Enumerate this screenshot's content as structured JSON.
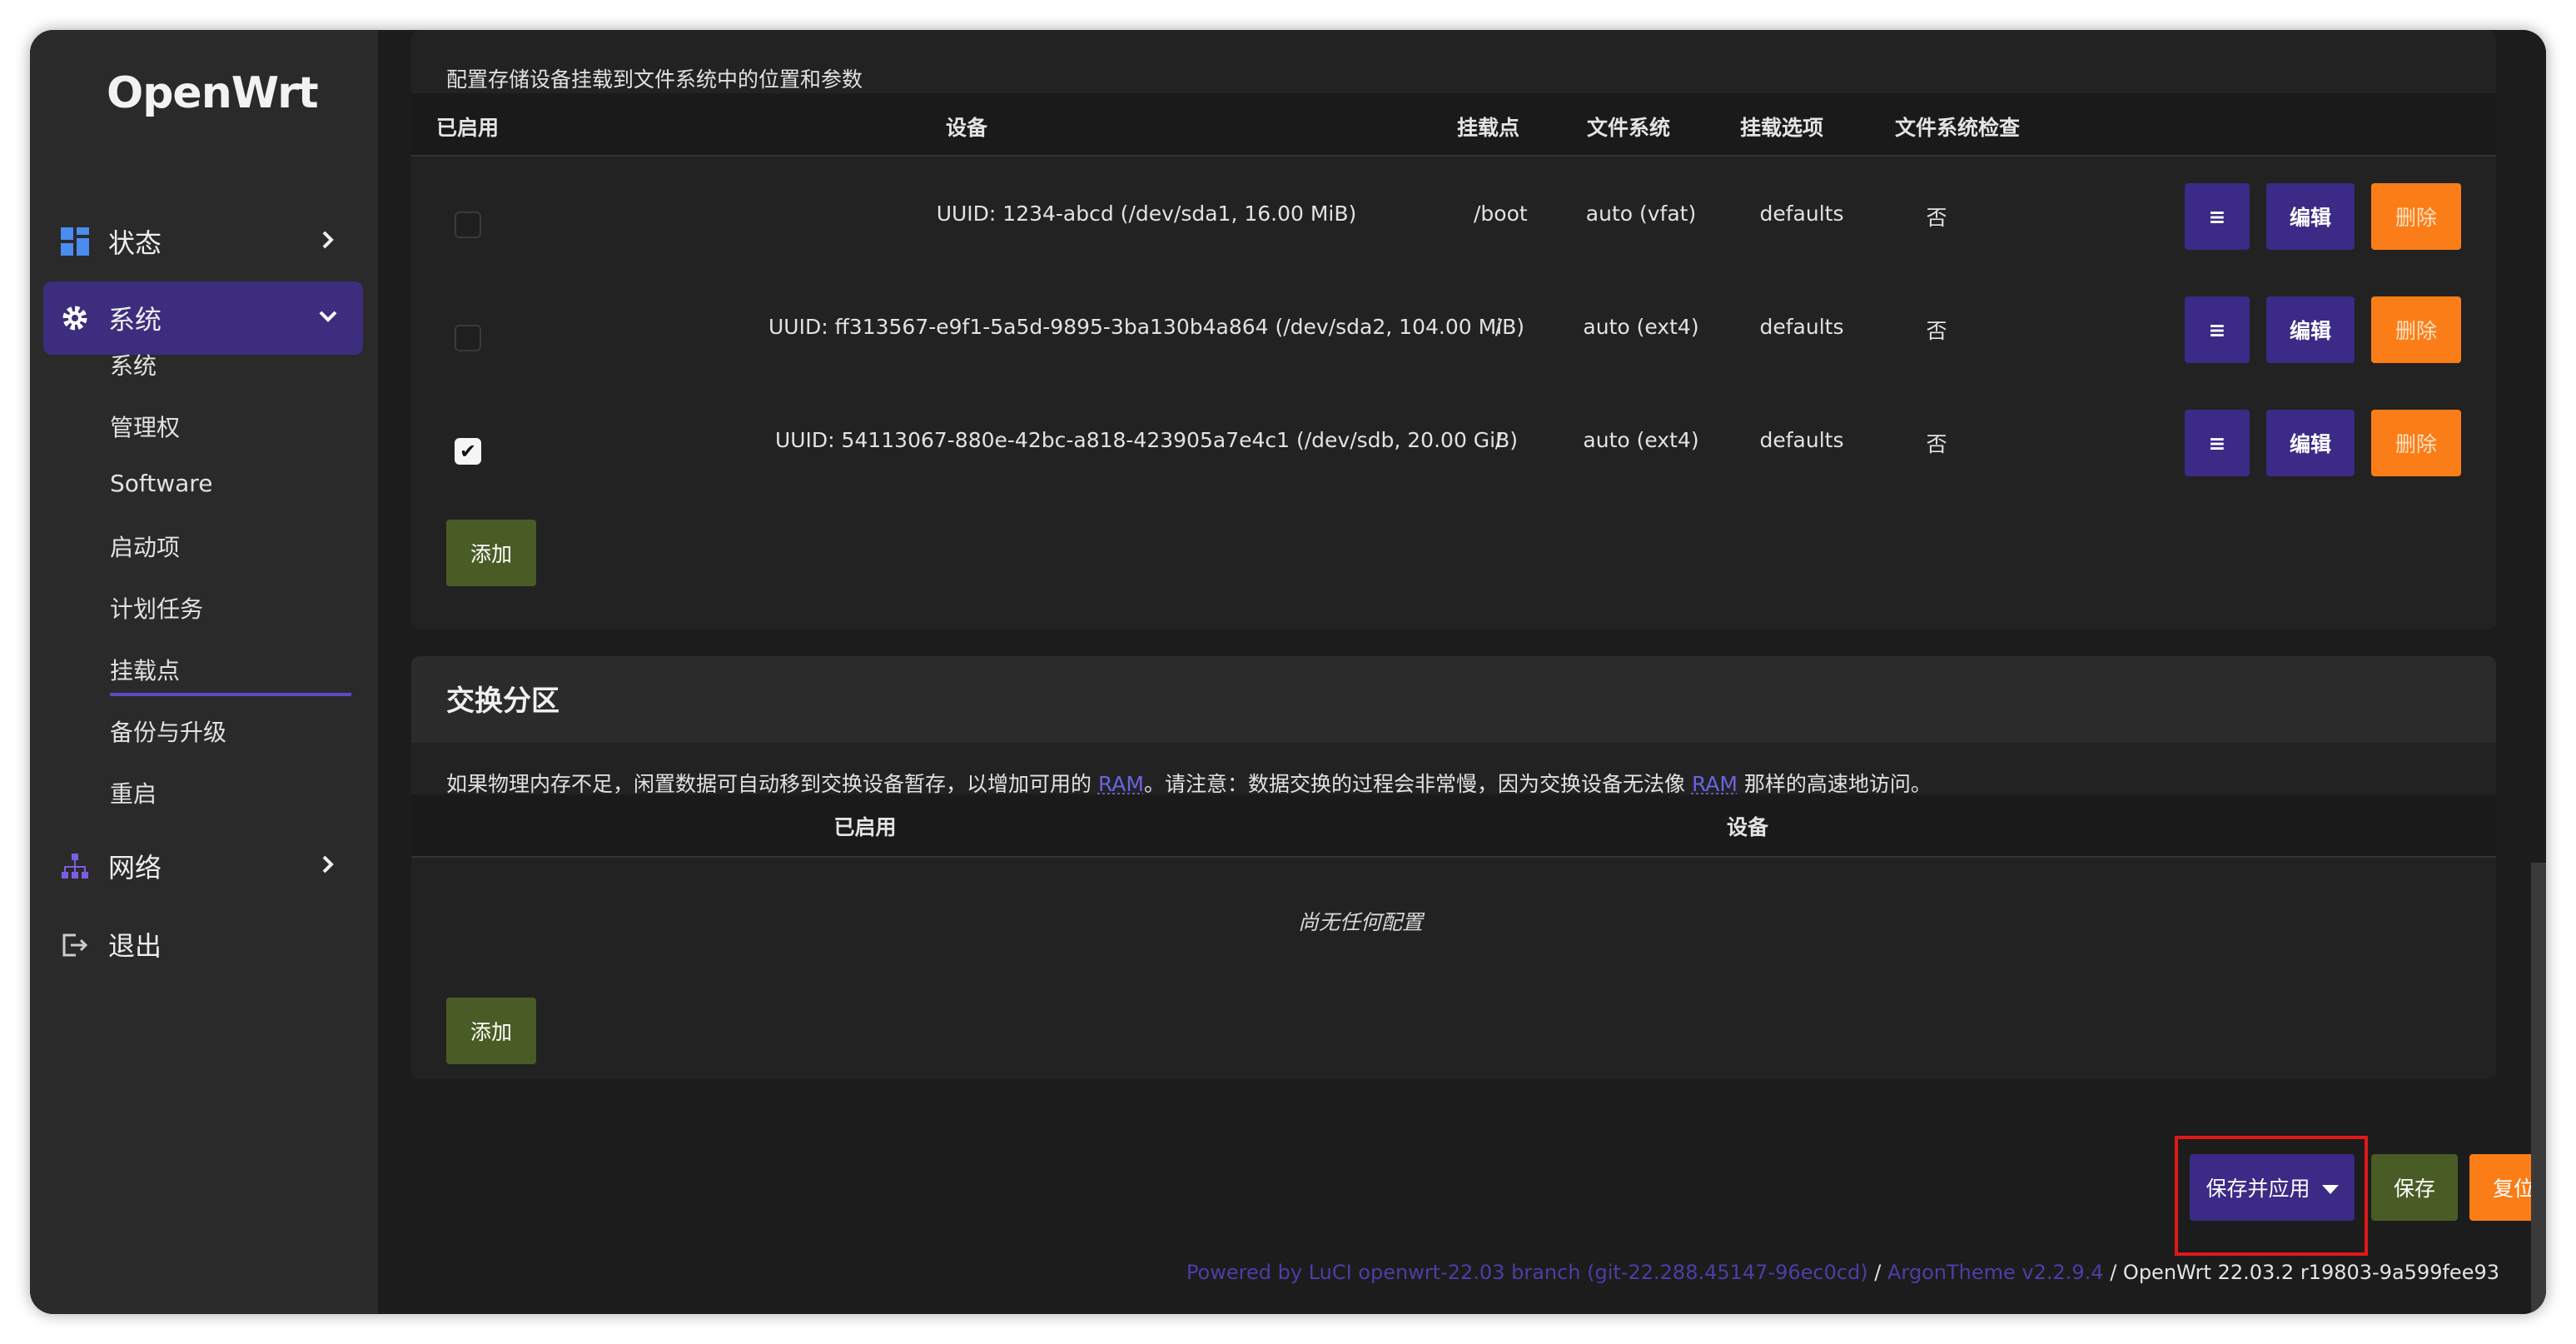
{
  "sidebar": {
    "logo": "OpenWrt",
    "status": "状态",
    "system": "系统",
    "sub_items": [
      "系统",
      "管理权",
      "Software",
      "启动项",
      "计划任务",
      "挂载点",
      "备份与升级",
      "重启"
    ],
    "network": "网络",
    "logout": "退出"
  },
  "mounts": {
    "description": "配置存储设备挂载到文件系统中的位置和参数",
    "headers": {
      "enabled": "已启用",
      "device": "设备",
      "mountpoint": "挂载点",
      "fs": "文件系统",
      "options": "挂载选项",
      "fsck": "文件系统检查"
    },
    "rows": [
      {
        "enabled": false,
        "device": "UUID: 1234-abcd (/dev/sda1, 16.00 MiB)",
        "mountpoint": "/boot",
        "fs": "auto (vfat)",
        "options": "defaults",
        "fsck": "否"
      },
      {
        "enabled": false,
        "device": "UUID: ff313567-e9f1-5a5d-9895-3ba130b4a864 (/dev/sda2, 104.00 MiB)",
        "mountpoint": "/",
        "fs": "auto (ext4)",
        "options": "defaults",
        "fsck": "否"
      },
      {
        "enabled": true,
        "device": "UUID: 54113067-880e-42bc-a818-423905a7e4c1 (/dev/sdb, 20.00 GiB)",
        "mountpoint": "/",
        "fs": "auto (ext4)",
        "options": "defaults",
        "fsck": "否"
      }
    ],
    "btn_drag": "≡",
    "btn_edit": "编辑",
    "btn_delete": "删除",
    "btn_add": "添加"
  },
  "swap": {
    "title": "交换分区",
    "desc_1": "如果物理内存不足，闲置数据可自动移到交换设备暂存，以增加可用的 ",
    "ram": "RAM",
    "desc_2": "。请注意：数据交换的过程会非常慢，因为交换设备无法像 ",
    "desc_3": " 那样的高速地访问。",
    "headers": {
      "enabled": "已启用",
      "device": "设备"
    },
    "empty": "尚无任何配置",
    "btn_add": "添加"
  },
  "actions": {
    "save_apply": "保存并应用",
    "save": "保存",
    "reset": "复位"
  },
  "footer": {
    "powered": "Powered by LuCI openwrt-22.03 branch (git-22.288.45147-96ec0cd)",
    "sep": " / ",
    "theme": "ArgonTheme v2.2.9.4",
    "version": "OpenWrt 22.03.2 r19803-9a599fee93"
  },
  "colors": {
    "accent": "#3b2a86",
    "danger": "#fb7d17",
    "success": "#4a5c25",
    "highlight": "#e01818"
  }
}
